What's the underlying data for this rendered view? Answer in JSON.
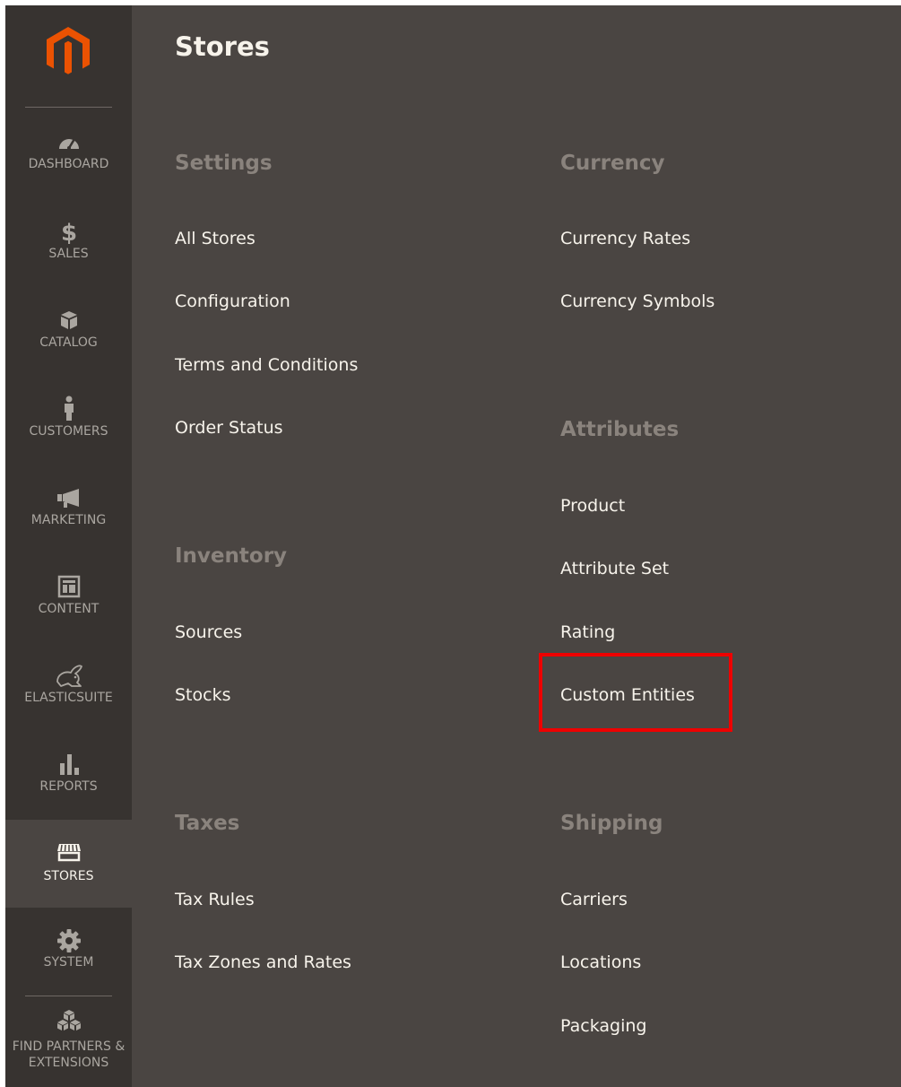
{
  "sidebar": {
    "items": [
      {
        "label": "DASHBOARD",
        "icon": "dashboard-icon"
      },
      {
        "label": "SALES",
        "icon": "dollar-icon"
      },
      {
        "label": "CATALOG",
        "icon": "catalog-box-icon"
      },
      {
        "label": "CUSTOMERS",
        "icon": "customer-person-icon"
      },
      {
        "label": "MARKETING",
        "icon": "megaphone-icon"
      },
      {
        "label": "CONTENT",
        "icon": "content-layout-icon"
      },
      {
        "label": "ELASTICSUITE",
        "icon": "rabbit-icon"
      },
      {
        "label": "REPORTS",
        "icon": "bar-chart-icon"
      },
      {
        "label": "STORES",
        "icon": "store-icon"
      },
      {
        "label": "SYSTEM",
        "icon": "gear-icon"
      },
      {
        "label": "FIND PARTNERS & EXTENSIONS",
        "icon": "partners-cubes-icon"
      }
    ],
    "active": "STORES"
  },
  "main": {
    "title": "Stores",
    "groups": {
      "settings": {
        "title": "Settings",
        "links": [
          "All Stores",
          "Configuration",
          "Terms and Conditions",
          "Order Status"
        ]
      },
      "inventory": {
        "title": "Inventory",
        "links": [
          "Sources",
          "Stocks"
        ]
      },
      "taxes": {
        "title": "Taxes",
        "links": [
          "Tax Rules",
          "Tax Zones and Rates"
        ]
      },
      "currency": {
        "title": "Currency",
        "links": [
          "Currency Rates",
          "Currency Symbols"
        ]
      },
      "attributes": {
        "title": "Attributes",
        "links": [
          "Product",
          "Attribute Set",
          "Rating",
          "Custom Entities"
        ]
      },
      "shipping": {
        "title": "Shipping",
        "links": [
          "Carriers",
          "Locations",
          "Packaging"
        ]
      }
    }
  },
  "colors": {
    "panel_bg": "#4a4542",
    "sidebar_bg": "#373330",
    "logo_orange": "#eb5202",
    "highlight_red": "#ee0000"
  }
}
